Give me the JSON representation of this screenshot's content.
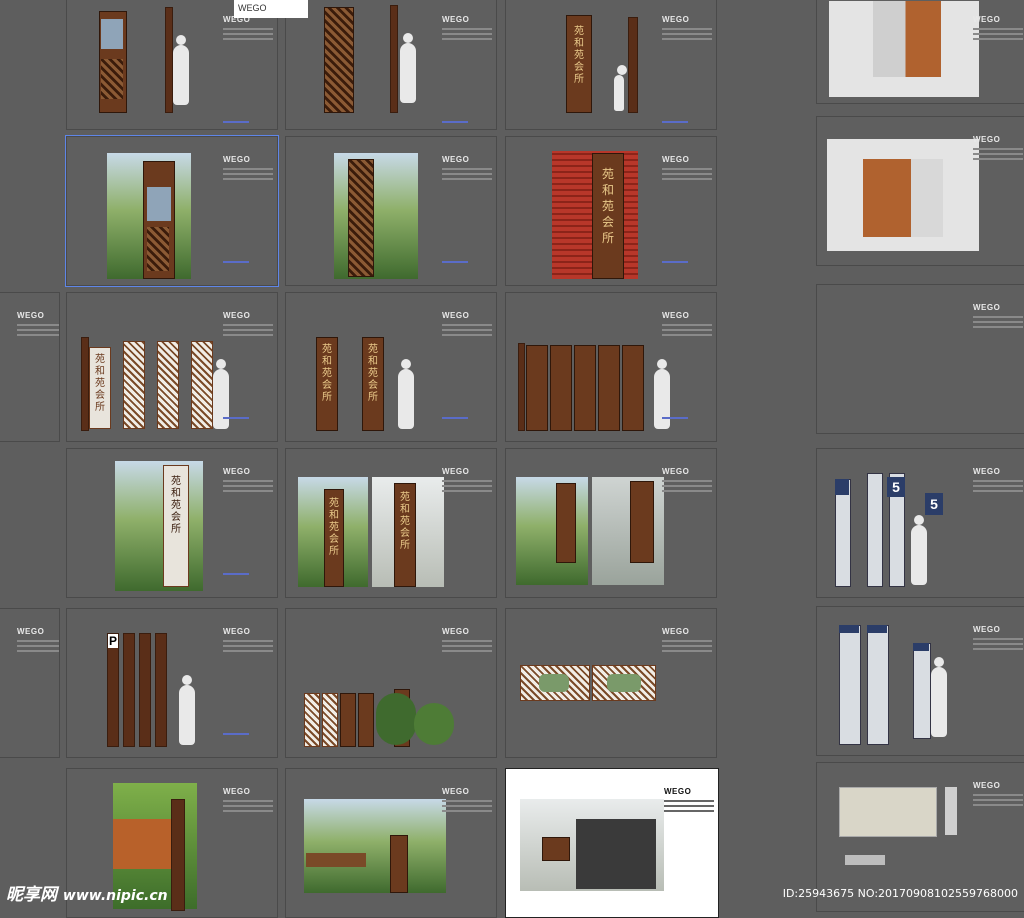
{
  "brand": "WEGO",
  "top_label": "WEGO",
  "columns": [
    {
      "boards": [
        {
          "id": "r1c1",
          "type": "elevation-drawing"
        },
        {
          "id": "r2c1",
          "type": "photo-sign-garden",
          "selected": true
        },
        {
          "id": "r3c1",
          "type": "elevation-four-panels",
          "characters": [
            "苑",
            "和",
            "苑",
            "会",
            "所"
          ]
        },
        {
          "id": "r4c1",
          "type": "photo-tall-sign",
          "characters": [
            "苑",
            "和",
            "苑",
            "会",
            "所"
          ]
        },
        {
          "id": "r5c1",
          "type": "elevation-posts",
          "parking_letter": "P"
        },
        {
          "id": "r6c1",
          "type": "photo-corten-wall"
        }
      ]
    },
    {
      "boards": [
        {
          "id": "r1c2",
          "type": "elevation-drawing"
        },
        {
          "id": "r2c2",
          "type": "photo-waterfall"
        },
        {
          "id": "r3c2",
          "type": "elevation-two-panels",
          "characters": [
            "苑",
            "和",
            "苑",
            "会",
            "所"
          ]
        },
        {
          "id": "r4c2",
          "type": "photo-pair",
          "characters": [
            "苑",
            "和",
            "苑",
            "会",
            "所"
          ]
        },
        {
          "id": "r5c2",
          "type": "elevation-lattice-row"
        },
        {
          "id": "r6c2",
          "type": "photo-planter"
        }
      ]
    },
    {
      "boards": [
        {
          "id": "r1c3",
          "type": "elevation-drawing",
          "characters": [
            "苑",
            "和",
            "苑",
            "会",
            "所"
          ]
        },
        {
          "id": "r2c3",
          "type": "photo-red-lattice",
          "characters": [
            "苑",
            "和",
            "苑",
            "会",
            "所"
          ]
        },
        {
          "id": "r3c3",
          "type": "elevation-five-panels"
        },
        {
          "id": "r4c3",
          "type": "photo-pair-two"
        },
        {
          "id": "r5c3",
          "type": "elevation-plaques"
        },
        {
          "id": "r6c3",
          "type": "photo-building",
          "active": true
        }
      ]
    },
    {
      "boards": [
        {
          "id": "r1c4",
          "type": "render-planter-box"
        },
        {
          "id": "r2c4",
          "type": "render-planter-box"
        },
        {
          "id": "r3c4",
          "type": "blank-watermark"
        },
        {
          "id": "r4c4",
          "type": "elevation-number-signs",
          "number": "5"
        },
        {
          "id": "r5c4",
          "type": "elevation-directory"
        },
        {
          "id": "r6c4",
          "type": "plan-drawing"
        }
      ]
    }
  ],
  "watermark": {
    "logo_text": "昵享网",
    "url": "www.nipic.cn"
  },
  "image_id": "ID:25943675 NO:20170908102559768000",
  "colors": {
    "background": "#5e5e5e",
    "wood": "#5a2e18",
    "accent_link": "#5a6cc8"
  }
}
